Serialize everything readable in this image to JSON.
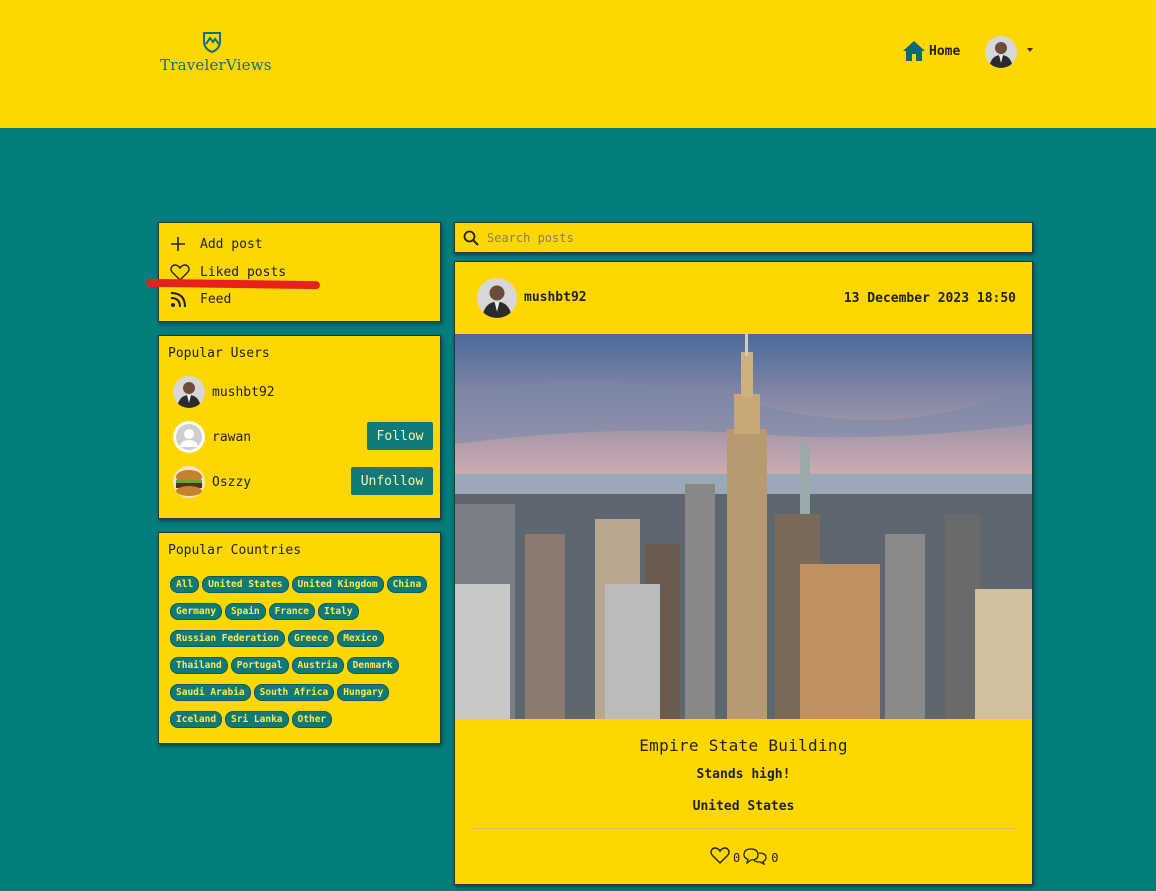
{
  "brand": {
    "name": "TravelerViews",
    "logo_icon": "mountain-shield-icon"
  },
  "nav": {
    "home_label": "Home",
    "home_icon": "home-icon",
    "profile_icon": "avatar"
  },
  "sidebar_menu": {
    "items": [
      {
        "label": "Add post",
        "icon": "plus-icon"
      },
      {
        "label": "Liked posts",
        "icon": "heart-icon"
      },
      {
        "label": "Feed",
        "icon": "rss-icon"
      }
    ]
  },
  "popular_users": {
    "title": "Popular Users",
    "users": [
      {
        "name": "mushbt92",
        "button": ""
      },
      {
        "name": "rawan",
        "button": "Follow"
      },
      {
        "name": "Oszzy",
        "button": "Unfollow"
      }
    ]
  },
  "popular_countries": {
    "title": "Popular Countries",
    "rows": [
      [
        "All",
        "United States",
        "United Kingdom",
        "China"
      ],
      [
        "Germany",
        "Spain",
        "France",
        "Italy"
      ],
      [
        "Russian Federation",
        "Greece",
        "Mexico"
      ],
      [
        "Thailand",
        "Portugal",
        "Austria",
        "Denmark"
      ],
      [
        "Saudi Arabia",
        "South Africa",
        "Hungary"
      ],
      [
        "Iceland",
        "Sri Lanka",
        "Other"
      ]
    ]
  },
  "search": {
    "placeholder": "Search posts"
  },
  "post": {
    "author": "mushbt92",
    "date": "13 December 2023 18:50",
    "title": "Empire State Building",
    "description": "Stands high!",
    "country": "United States",
    "likes": "0",
    "comments": "0"
  },
  "colors": {
    "background": "#047d7d",
    "panel": "#ffd700",
    "accent": "#0f7a7a",
    "annotation": "#e8211d"
  }
}
